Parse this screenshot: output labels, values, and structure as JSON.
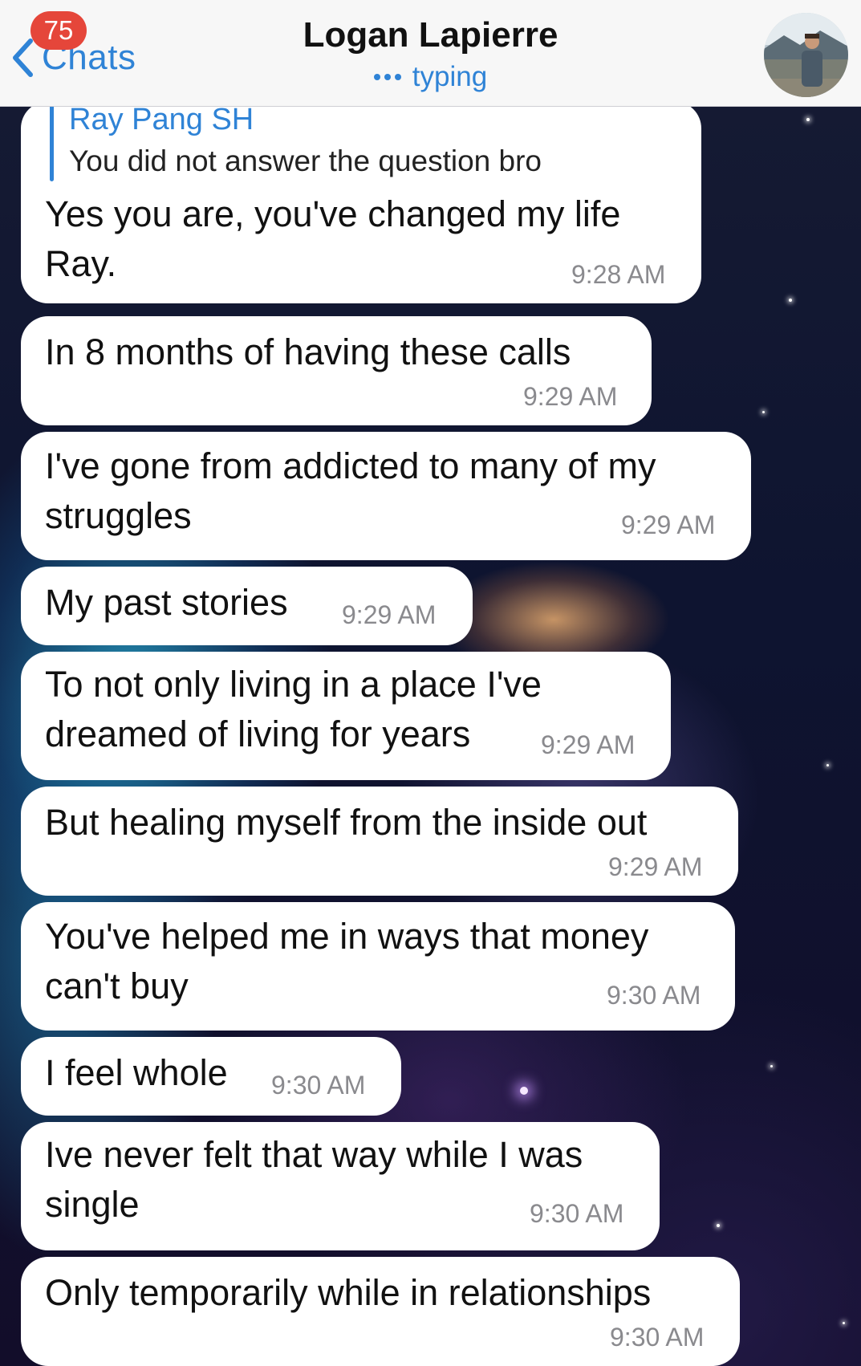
{
  "header": {
    "back_label": "Chats",
    "unread_count": "75",
    "contact_name": "Logan Lapierre",
    "status": "typing"
  },
  "messages": [
    {
      "reply_to": {
        "name": "Ray Pang SH",
        "text": "You did not answer the question bro"
      },
      "lines": [
        "Yes you are, you've changed my life",
        "Ray."
      ],
      "time": "9:28 AM"
    },
    {
      "lines": [
        "In 8 months of having these calls"
      ],
      "time": "9:29 AM"
    },
    {
      "lines": [
        "I've gone from addicted to many of my",
        "struggles"
      ],
      "time": "9:29 AM"
    },
    {
      "lines": [
        "My past stories"
      ],
      "time": "9:29 AM"
    },
    {
      "lines": [
        "To not only living in a place I've",
        "dreamed of living for years"
      ],
      "time": "9:29 AM"
    },
    {
      "lines": [
        "But healing myself from the inside out"
      ],
      "time": "9:29 AM"
    },
    {
      "lines": [
        "You've helped me in ways that money",
        "can't buy"
      ],
      "time": "9:30 AM"
    },
    {
      "lines": [
        "I feel whole"
      ],
      "time": "9:30 AM"
    },
    {
      "lines": [
        "Ive never felt that way while I was",
        "single"
      ],
      "time": "9:30 AM"
    },
    {
      "lines": [
        "Only temporarily while in relationships"
      ],
      "time": "9:30 AM"
    }
  ],
  "colors": {
    "accent": "#2f83d6",
    "badge": "#e5463a",
    "bubble": "#ffffff",
    "timestamp": "#8a8a8e"
  },
  "icons": {
    "back": "chevron-left-icon",
    "typing": "typing-dots-icon"
  }
}
